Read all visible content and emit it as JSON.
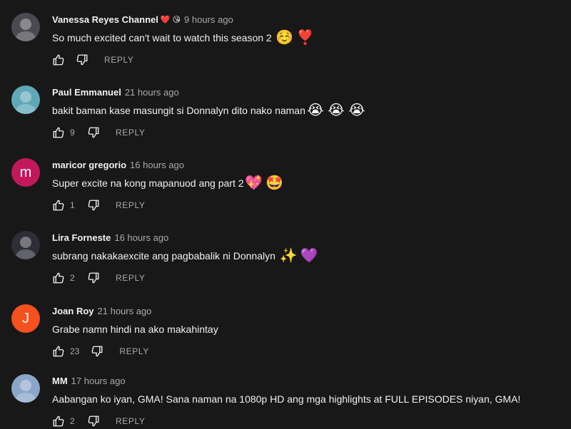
{
  "comments": [
    {
      "author": "Vanessa Reyes Channel",
      "badges": [
        "❤️",
        "😘"
      ],
      "time": "9 hours ago",
      "text": "So much excited can't wait to watch this season 2",
      "emojis": [
        "☺️",
        "❣️"
      ],
      "likes": "",
      "reply_label": "REPLY",
      "avatar": {
        "type": "photo",
        "color": "#4a4a52"
      }
    },
    {
      "author": "Paul Emmanuel",
      "badges": [],
      "time": "21 hours ago",
      "text": "bakit baman kase masungit si Donnalyn dito nako naman",
      "emojis": [
        "😭",
        "😭",
        "😭"
      ],
      "likes": "9",
      "reply_label": "REPLY",
      "avatar": {
        "type": "photo",
        "color": "#5fa8b8"
      }
    },
    {
      "author": "maricor gregorio",
      "badges": [],
      "time": "16 hours ago",
      "text": "Super excite na kong mapanuod ang part 2",
      "emojis": [
        "💖",
        "🤩"
      ],
      "likes": "1",
      "reply_label": "REPLY",
      "avatar": {
        "type": "letter",
        "letter": "m",
        "color": "#c2185b"
      }
    },
    {
      "author": "Lira Forneste",
      "badges": [],
      "time": "16 hours ago",
      "text": "subrang nakakaexcite ang pagbabalik ni Donnalyn",
      "emojis": [
        "✨",
        "💜"
      ],
      "likes": "2",
      "reply_label": "REPLY",
      "avatar": {
        "type": "photo",
        "color": "#2e2e38"
      }
    },
    {
      "author": "Joan Roy",
      "badges": [],
      "time": "21 hours ago",
      "text": "Grabe namn hindi na ako makahintay",
      "emojis": [],
      "likes": "23",
      "reply_label": "REPLY",
      "avatar": {
        "type": "letter",
        "letter": "J",
        "color": "#f4511e"
      }
    },
    {
      "author": "MM",
      "badges": [],
      "time": "17 hours ago",
      "text": "Aabangan ko iyan, GMA! Sana naman na 1080p HD ang mga highlights at FULL EPISODES niyan, GMA!",
      "emojis": [],
      "likes": "2",
      "reply_label": "REPLY",
      "avatar": {
        "type": "photo",
        "color": "#8aa6c8"
      }
    }
  ]
}
